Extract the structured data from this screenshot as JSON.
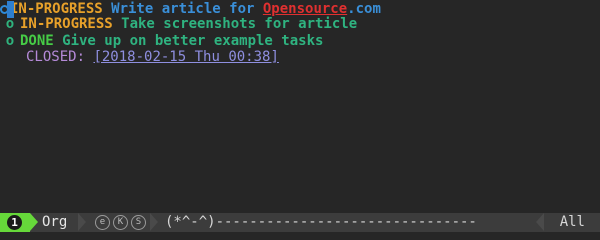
{
  "colors": {
    "background": "#262626",
    "modeline_bg": "#3c3c3c",
    "in_progress": "#e8a12a",
    "done": "#46cc46",
    "heading1": "#3a8fd8",
    "heading2": "#2fb380",
    "link": "#e03030",
    "closed_keyword": "#b58ad8",
    "timestamp": "#8f8fe0",
    "window_number_bg": "#66d83a"
  },
  "buffer": {
    "heading": {
      "keyword": "IN-PROGRESS",
      "text_before_link": " Write article for ",
      "link_text": "Opensource",
      "text_after_link": ".com"
    },
    "subtasks": [
      {
        "bullet": "o",
        "keyword": "IN-PROGRESS",
        "text": " Take screenshots for article"
      },
      {
        "bullet": "o",
        "keyword": "DONE",
        "text": " Give up on better example tasks"
      }
    ],
    "closed": {
      "label": "CLOSED:",
      "timestamp": "[2018-02-15 Thu 00:38]"
    }
  },
  "modeline": {
    "window_number": "1",
    "major_mode": "Org",
    "minor_modes": [
      "e",
      "K",
      "S"
    ],
    "status": "(*^-^)-------------------------------",
    "position": "All"
  }
}
